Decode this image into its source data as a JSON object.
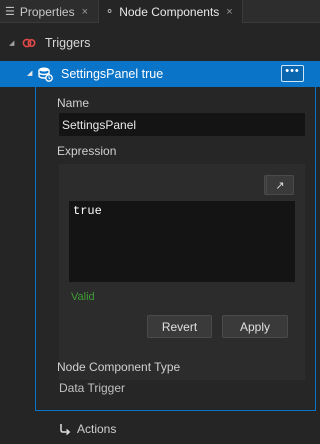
{
  "tabs": [
    {
      "label": "Properties",
      "icon": "list-icon"
    },
    {
      "label": "Node Components",
      "icon": "node-components-icon"
    }
  ],
  "tab_close_glyph": "×",
  "section": {
    "label": "Triggers",
    "icon": "trigger-icon"
  },
  "item": {
    "title": "SettingsPanel true",
    "icon": "data-trigger-icon",
    "more_label": "•••"
  },
  "name_field": {
    "label": "Name",
    "value": "SettingsPanel"
  },
  "expression": {
    "label": "Expression",
    "braces_label": "{ }",
    "expand_label": "↗",
    "code": "true",
    "status": "Valid",
    "status_color": "#3f9c35",
    "revert_label": "Revert",
    "apply_label": "Apply"
  },
  "component_type": {
    "label": "Node Component Type",
    "value": "Data Trigger"
  },
  "actions": {
    "label": "Actions",
    "icon": "action-icon"
  },
  "colors": {
    "accent": "#0a74c8",
    "background": "#252526"
  }
}
